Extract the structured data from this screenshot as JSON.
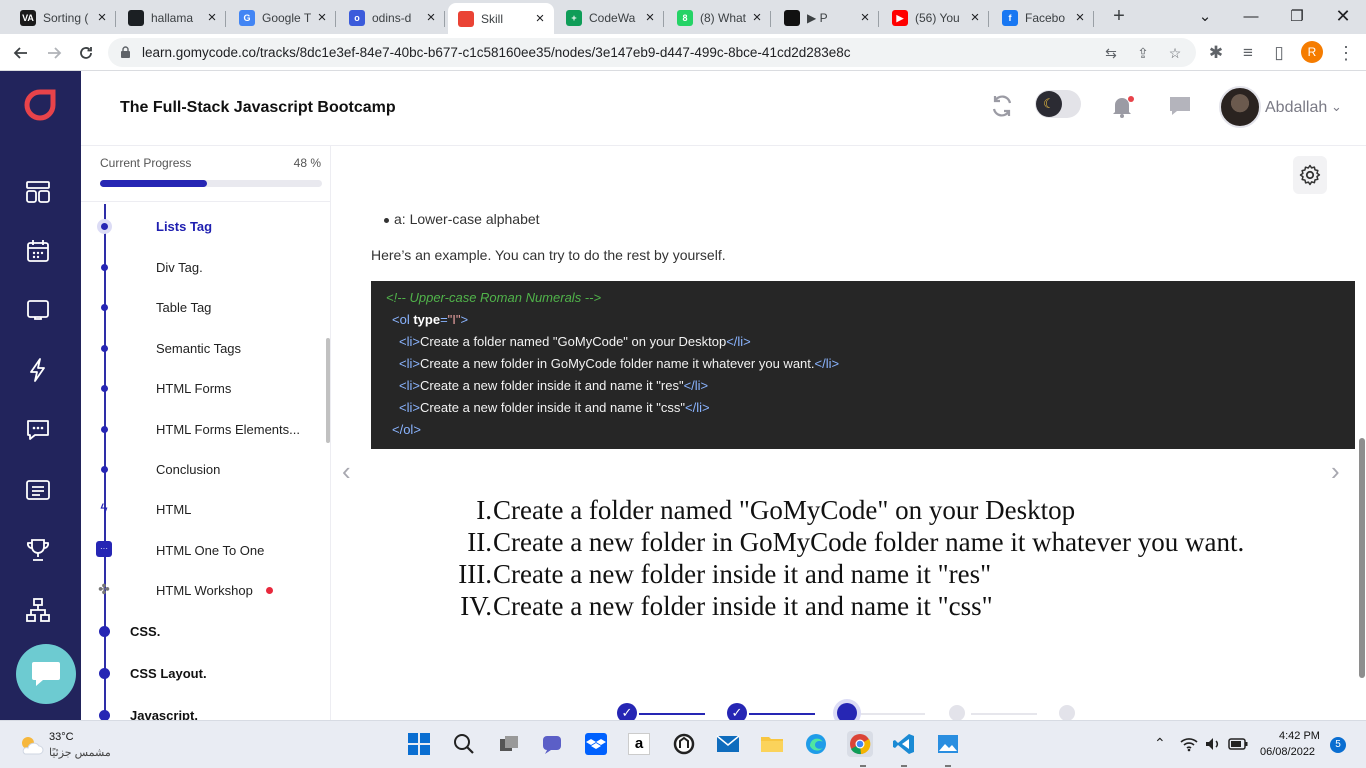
{
  "browser": {
    "tabs": [
      {
        "title": "Sorting (",
        "icon": "va-icon",
        "color": "#1a1a1a",
        "letter": "VA"
      },
      {
        "title": "hallama",
        "icon": "github-icon",
        "color": "#1b1f23",
        "letter": ""
      },
      {
        "title": "Google T",
        "icon": "google-translate-icon",
        "color": "#4285f4",
        "letter": "G"
      },
      {
        "title": "odins-d",
        "icon": "odin-icon",
        "color": "#3b5bdb",
        "letter": "o"
      },
      {
        "title": "Skill",
        "icon": "gomycode-icon",
        "color": "#ea4335",
        "letter": ""
      },
      {
        "title": "CodeWa",
        "icon": "sheets-icon",
        "color": "#0f9d58",
        "letter": "+"
      },
      {
        "title": "(8) What",
        "icon": "whatsapp-icon",
        "color": "#25d366",
        "letter": "8"
      },
      {
        "title": "▶ P",
        "icon": "media-icon",
        "color": "#111",
        "letter": ""
      },
      {
        "title": "(56) You",
        "icon": "youtube-icon",
        "color": "#ff0000",
        "letter": "▶"
      },
      {
        "title": "Facebo",
        "icon": "facebook-icon",
        "color": "#1877f2",
        "letter": "f"
      }
    ],
    "new_tab": "+",
    "url": "learn.gomycode.co/tracks/8dc1e3ef-84e7-40bc-b677-c1c58160ee35/nodes/3e147eb9-d447-499c-8bce-41cd2d283e8c",
    "profile_letter": "R"
  },
  "header": {
    "course_title": "The Full-Stack Javascript Bootcamp",
    "user_name": "Abdallah"
  },
  "sidebar": {
    "progress_label": "Current Progress",
    "progress_pct": "48 %",
    "progress_value": 0.48,
    "lessons": [
      {
        "label": "Lists Tag",
        "active": true
      },
      {
        "label": "Div Tag.",
        "active": false
      },
      {
        "label": "Table Tag",
        "active": false
      },
      {
        "label": "Semantic Tags",
        "active": false
      },
      {
        "label": "HTML Forms",
        "active": false
      },
      {
        "label": "HTML Forms Elements...",
        "active": false
      },
      {
        "label": "Conclusion",
        "active": false
      },
      {
        "label": "HTML",
        "icon": "lightning-icon"
      },
      {
        "label": "HTML One To One",
        "icon": "chat-icon"
      },
      {
        "label": "HTML Workshop",
        "icon": "puzzle-icon"
      }
    ],
    "modules": [
      "CSS.",
      "CSS Layout.",
      "Javascript."
    ]
  },
  "content": {
    "bullet": "a: Lower-case alphabet",
    "example_text": "Here’s an example. You can try to do the rest by yourself.",
    "code": {
      "comment": "<!-- Upper-case Roman Numerals -->",
      "ol_open_tag": "<ol",
      "ol_attr": "type",
      "ol_eq": "=",
      "ol_val": "\"I\"",
      "ol_close": ">",
      "li_items": [
        "Create a folder named \"GoMyCode\" on your Desktop",
        "Create a new folder in GoMyCode folder name it whatever you want.",
        "Create a new folder inside it and name it \"res\"",
        "Create a new folder inside it and name it \"css\""
      ],
      "li_open": "<li>",
      "li_close": "</li>",
      "ol_end": "</ol>"
    },
    "rendered_list": {
      "numerals": [
        "I.",
        "II.",
        "III.",
        "IV."
      ],
      "items": [
        "Create a folder named \"GoMyCode\" on your Desktop",
        "Create a new folder in GoMyCode folder name it whatever you want.",
        "Create a new folder inside it and name it \"res\"",
        "Create a new folder inside it and name it \"css\""
      ]
    },
    "stepper": [
      "done",
      "done",
      "current",
      "todo",
      "todo"
    ]
  },
  "taskbar": {
    "weather_temp": "33°C",
    "weather_desc": "مشمس جزئيًا",
    "time": "4:42 PM",
    "date": "06/08/2022",
    "notification_count": "5"
  },
  "colors": {
    "brand_navy": "#22245c",
    "accent_blue": "#2626b4",
    "brand_red": "#e8434a",
    "chat_teal": "#6dcbd1"
  }
}
